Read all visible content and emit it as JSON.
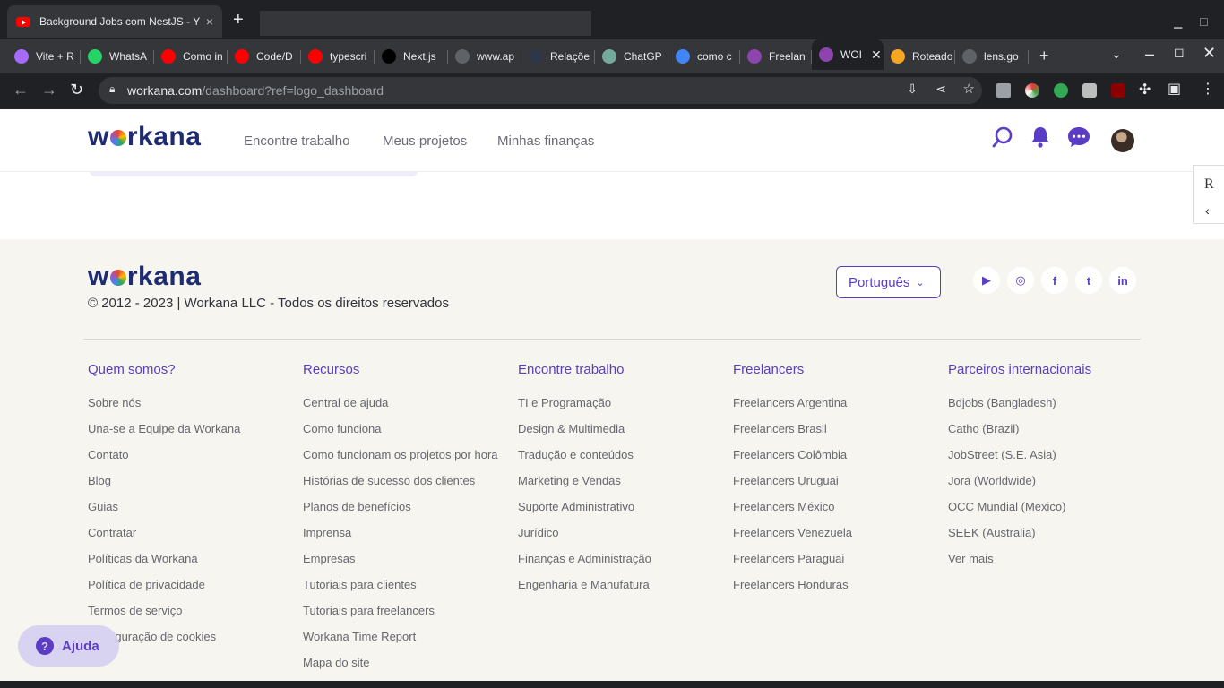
{
  "window": {
    "tab_title": "Background Jobs com NestJS - Y",
    "tab_close": "×",
    "new_tab": "+"
  },
  "tabs": [
    {
      "label": "Vite + R",
      "icon": "vite-icon",
      "color": "#a76bfa"
    },
    {
      "label": "WhatsA",
      "icon": "whatsapp-icon",
      "color": "#25d366"
    },
    {
      "label": "Como in",
      "icon": "youtube-icon",
      "color": "#ff0000"
    },
    {
      "label": "Code/D",
      "icon": "youtube-icon",
      "color": "#ff0000"
    },
    {
      "label": "typescri",
      "icon": "youtube-icon",
      "color": "#ff0000"
    },
    {
      "label": "Next.js",
      "icon": "nextjs-icon",
      "color": "#000000"
    },
    {
      "label": "www.ap",
      "icon": "globe-icon",
      "color": "#5f6368"
    },
    {
      "label": "Relaçõe",
      "icon": "prisma-icon",
      "color": "#2d3748"
    },
    {
      "label": "ChatGP",
      "icon": "chatgpt-icon",
      "color": "#74aa9c"
    },
    {
      "label": "como c",
      "icon": "google-icon",
      "color": "#4285f4"
    },
    {
      "label": "Freelan",
      "icon": "workana-icon",
      "color": "#8e44ad"
    },
    {
      "label": "WOI",
      "icon": "workana-icon",
      "color": "#8e44ad",
      "active": true
    },
    {
      "label": "Roteado",
      "icon": "router-icon",
      "color": "#f5a623"
    },
    {
      "label": "lens.go",
      "icon": "lens-icon",
      "color": "#5f6368"
    }
  ],
  "address_bar": {
    "host": "workana.com",
    "path": "/dashboard?ref=logo_dashboard"
  },
  "header": {
    "logo": "workana",
    "nav": [
      "Encontre trabalho",
      "Meus projetos",
      "Minhas finanças"
    ]
  },
  "side_panel": {
    "letter": "R",
    "chevron": "‹"
  },
  "footer": {
    "logo": "workana",
    "copyright": "© 2012 - 2023 | Workana LLC - Todos os direitos reservados",
    "language": "Português",
    "social": [
      {
        "name": "youtube-icon",
        "glyph": "▶"
      },
      {
        "name": "instagram-icon",
        "glyph": "◎"
      },
      {
        "name": "facebook-icon",
        "glyph": "f"
      },
      {
        "name": "twitter-icon",
        "glyph": "t"
      },
      {
        "name": "linkedin-icon",
        "glyph": "in"
      }
    ],
    "columns": [
      {
        "title": "Quem somos?",
        "links": [
          "Sobre nós",
          "Una-se a Equipe da Workana",
          "Contato",
          "Blog",
          "Guias",
          "Contratar",
          "Políticas da Workana",
          "Política de privacidade",
          "Termos de serviço",
          "Configuração de cookies"
        ]
      },
      {
        "title": "Recursos",
        "links": [
          "Central de ajuda",
          "Como funciona",
          "Como funcionam os projetos por hora",
          "Histórias de sucesso dos clientes",
          "Planos de benefícios",
          "Imprensa",
          "Empresas",
          "Tutoriais para clientes",
          "Tutoriais para freelancers",
          "Workana Time Report",
          "Mapa do site"
        ]
      },
      {
        "title": "Encontre trabalho",
        "links": [
          "TI e Programação",
          "Design & Multimedia",
          "Tradução e conteúdos",
          "Marketing e Vendas",
          "Suporte Administrativo",
          "Jurídico",
          "Finanças e Administração",
          "Engenharia e Manufatura"
        ]
      },
      {
        "title": "Freelancers",
        "links": [
          "Freelancers Argentina",
          "Freelancers Brasil",
          "Freelancers Colômbia",
          "Freelancers Uruguai",
          "Freelancers México",
          "Freelancers Venezuela",
          "Freelancers Paraguai",
          "Freelancers Honduras"
        ]
      },
      {
        "title": "Parceiros internacionais",
        "links": [
          "Bdjobs (Bangladesh)",
          "Catho (Brazil)",
          "JobStreet (S.E. Asia)",
          "Jora (Worldwide)",
          "OCC Mundial (Mexico)",
          "SEEK (Australia)",
          "Ver mais"
        ]
      }
    ]
  },
  "help_button": {
    "label": "Ajuda",
    "glyph": "?"
  },
  "colors": {
    "brand": "#5b3cc4",
    "logo": "#1d2b73",
    "footer_bg": "#f6f5ef"
  }
}
